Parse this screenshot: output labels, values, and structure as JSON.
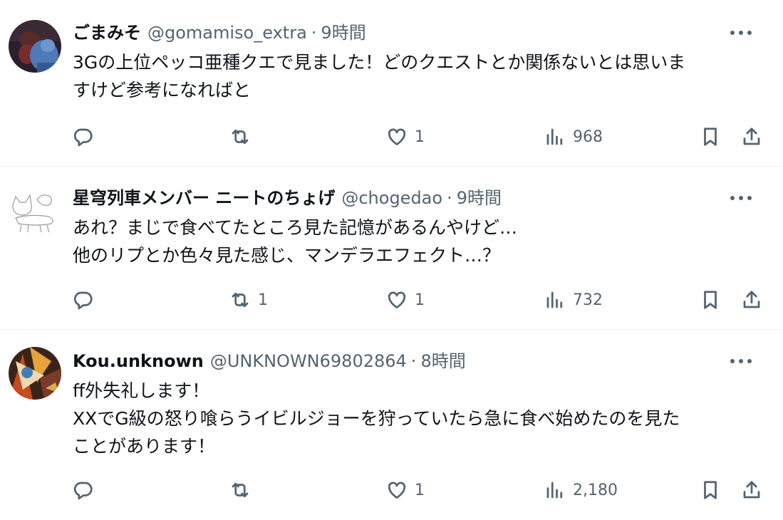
{
  "tweets": [
    {
      "display_name": "ごまみそ",
      "handle": "@gomamiso_extra",
      "time": "9時間",
      "lines": [
        "3Gの上位ペッコ亜種クエで見ました！どのクエストとか関係ないとは思いま",
        "すけど参考になればと"
      ],
      "replies": "",
      "retweets": "",
      "likes": "1",
      "views": "968"
    },
    {
      "display_name": "星穹列車メンバー ニートのちょげ",
      "handle": "@chogedao",
      "time": "9時間",
      "lines": [
        "あれ？まじで食べてたところ見た記憶があるんやけど…",
        "他のリプとか色々見た感じ、マンデラエフェクト…？"
      ],
      "replies": "",
      "retweets": "1",
      "likes": "1",
      "views": "732"
    },
    {
      "display_name": "Kou.unknown",
      "handle": "@UNKNOWN69802864",
      "time": "8時間",
      "lines": [
        "ff外失礼します！",
        "XXでG級の怒り喰らうイビルジョーを狩っていたら急に食べ始めたのを見た",
        "ことがあります！"
      ],
      "replies": "",
      "retweets": "",
      "likes": "1",
      "views": "2,180"
    }
  ],
  "separator": "·",
  "icons": [
    "more-icon",
    "reply-icon",
    "retweet-icon",
    "like-icon",
    "views-icon",
    "bookmark-icon",
    "share-icon"
  ],
  "colors": {
    "text": "#0f1419",
    "secondary": "#536471",
    "divider": "#eff3f4"
  }
}
